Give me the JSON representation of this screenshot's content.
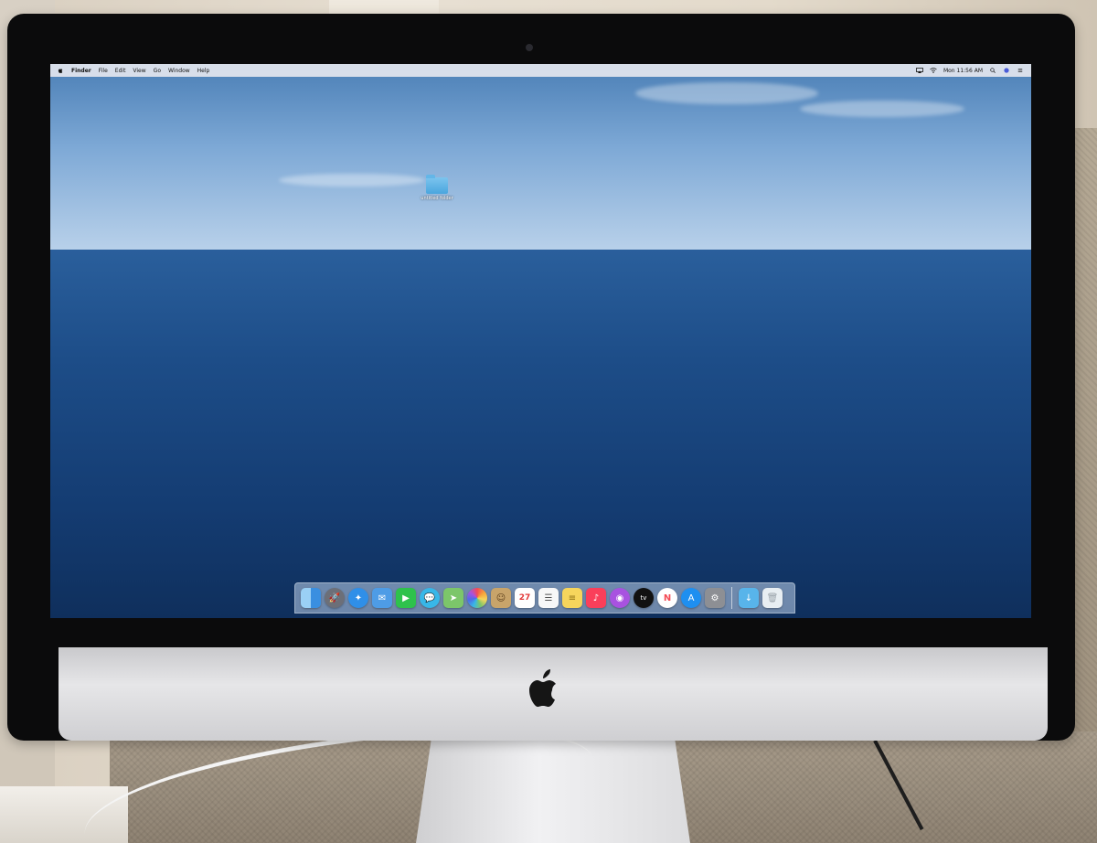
{
  "menubar": {
    "app_name": "Finder",
    "menus": [
      "File",
      "Edit",
      "View",
      "Go",
      "Window",
      "Help"
    ],
    "clock": "Mon 11:56 AM"
  },
  "desktop": {
    "folder_label": "untitled folder"
  },
  "dock": {
    "calendar_day": "27",
    "tv_label": "tv",
    "apps": [
      {
        "name": "finder-icon",
        "color": "#3a8fe0"
      },
      {
        "name": "launchpad-icon",
        "color": "#6c6f78"
      },
      {
        "name": "safari-icon",
        "color": "#2f8fe8"
      },
      {
        "name": "mail-icon",
        "color": "#4e9ce6"
      },
      {
        "name": "facetime-icon",
        "color": "#2ec24c"
      },
      {
        "name": "messages-icon",
        "color": "#38b7e8"
      },
      {
        "name": "maps-icon",
        "color": "#7cc66a"
      },
      {
        "name": "photos-icon",
        "color": "#f2f2f2"
      },
      {
        "name": "contacts-icon",
        "color": "#c8a46a"
      },
      {
        "name": "calendar-icon",
        "color": "#ffffff"
      },
      {
        "name": "reminders-icon",
        "color": "#f7f7f7"
      },
      {
        "name": "notes-icon",
        "color": "#f6d55c"
      },
      {
        "name": "music-icon",
        "color": "#fa3f5a"
      },
      {
        "name": "podcasts-icon",
        "color": "#a852e0"
      },
      {
        "name": "tv-icon",
        "color": "#111111"
      },
      {
        "name": "news-icon",
        "color": "#f44b55"
      },
      {
        "name": "app-store-icon",
        "color": "#1e8ff0"
      },
      {
        "name": "system-preferences-icon",
        "color": "#8d8f94"
      }
    ],
    "trailing": [
      {
        "name": "downloads-folder-icon",
        "color": "#58b4ea"
      },
      {
        "name": "trash-icon",
        "color": "#e8eef2"
      }
    ]
  }
}
